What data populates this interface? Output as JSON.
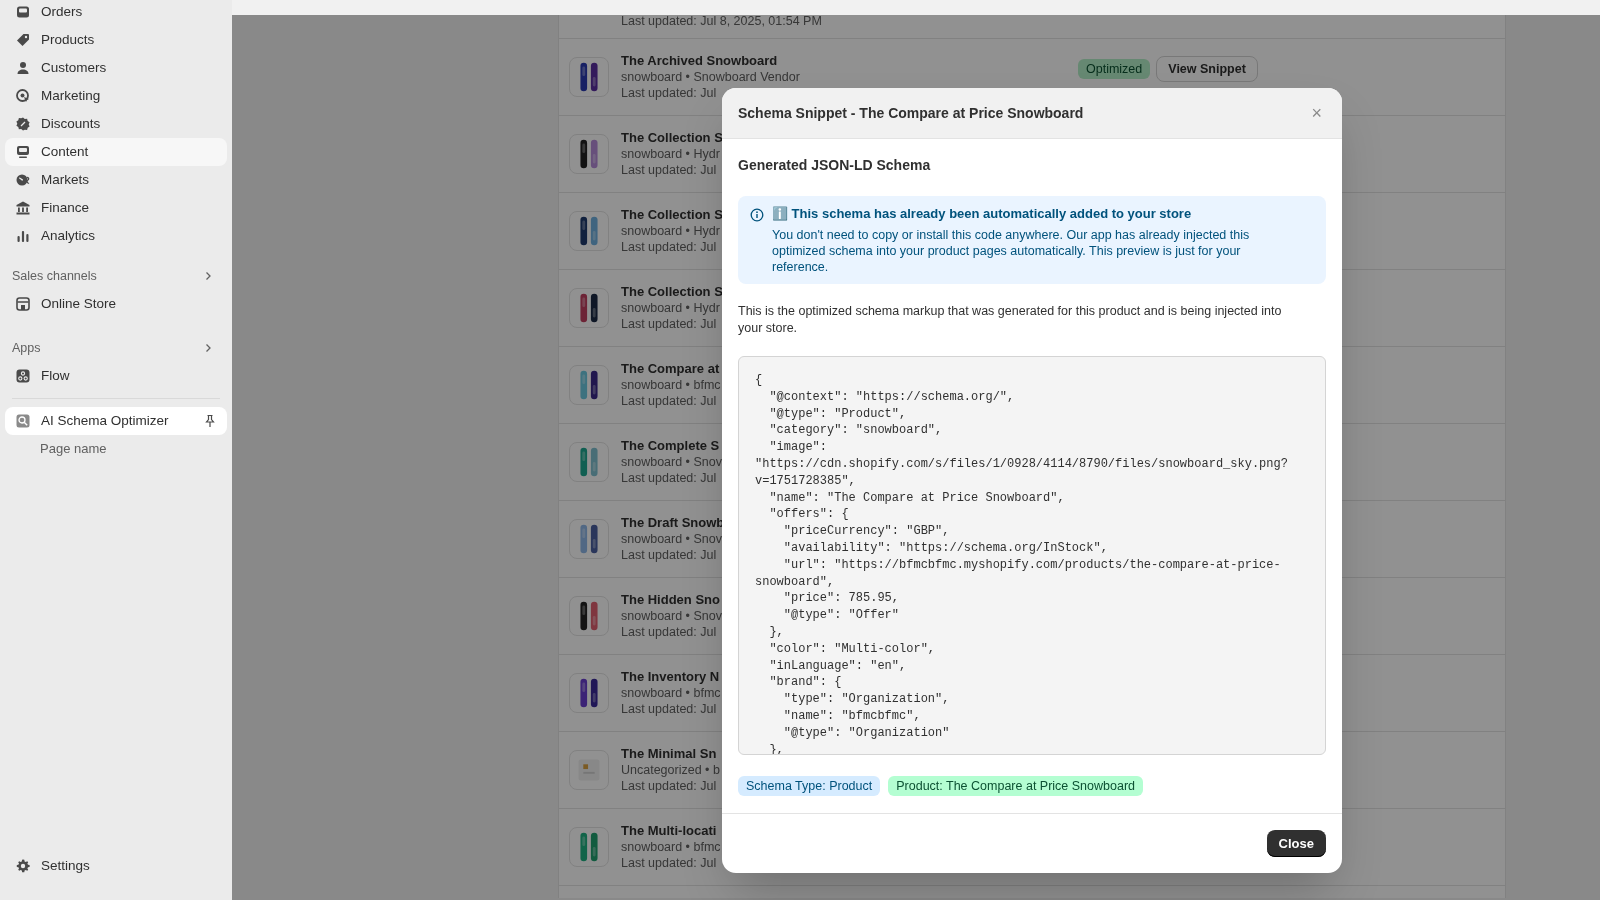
{
  "sidebar": {
    "nav": [
      {
        "label": "Orders",
        "selected": false
      },
      {
        "label": "Products",
        "selected": false
      },
      {
        "label": "Customers",
        "selected": false
      },
      {
        "label": "Marketing",
        "selected": false
      },
      {
        "label": "Discounts",
        "selected": false
      },
      {
        "label": "Content",
        "selected": true
      },
      {
        "label": "Markets",
        "selected": false
      },
      {
        "label": "Finance",
        "selected": false
      },
      {
        "label": "Analytics",
        "selected": false
      }
    ],
    "sales_channels": {
      "heading": "Sales channels",
      "items": [
        {
          "label": "Online Store"
        }
      ]
    },
    "apps": {
      "heading": "Apps",
      "items": [
        {
          "label": "Flow",
          "selected": false
        }
      ]
    },
    "app": {
      "label": "AI Schema Optimizer",
      "selected": true,
      "subitems": [
        "Page name"
      ]
    },
    "settings": "Settings"
  },
  "product_list": {
    "top_row_updated": "Last updated: Jul 8, 2025, 01:54 PM",
    "rows": [
      {
        "title": "The Archived Snowboard",
        "subtitle": "snowboard • Snowboard Vendor",
        "updated": "Last updated: Jul",
        "status": "Optimized",
        "action": "View Snippet"
      },
      {
        "title": "The Collection S",
        "subtitle": "snowboard • Hydr",
        "updated": "Last updated: Jul"
      },
      {
        "title": "The Collection S",
        "subtitle": "snowboard • Hydr",
        "updated": "Last updated: Jul"
      },
      {
        "title": "The Collection S",
        "subtitle": "snowboard • Hydr",
        "updated": "Last updated: Jul"
      },
      {
        "title": "The Compare at",
        "subtitle": "snowboard • bfmc",
        "updated": "Last updated: Jul"
      },
      {
        "title": "The Complete S",
        "subtitle": "snowboard • Snov",
        "updated": "Last updated: Jul"
      },
      {
        "title": "The Draft Snowb",
        "subtitle": "snowboard • Snov",
        "updated": "Last updated: Jul"
      },
      {
        "title": "The Hidden Sno",
        "subtitle": "snowboard • Snov",
        "updated": "Last updated: Jul"
      },
      {
        "title": "The Inventory N",
        "subtitle": "snowboard • bfmc",
        "updated": "Last updated: Jul"
      },
      {
        "title": "The Minimal Sn",
        "subtitle": "Uncategorized • b",
        "updated": "Last updated: Jul"
      },
      {
        "title": "The Multi-locati",
        "subtitle": "snowboard • bfmc",
        "updated": "Last updated: Jul"
      }
    ]
  },
  "modal": {
    "title": "Schema Snippet - The Compare at Price Snowboard",
    "close_icon": "×",
    "heading": "Generated JSON-LD Schema",
    "notice": {
      "title": "ℹ️ This schema has already been automatically added to your store",
      "body": "You don't need to copy or install this code anywhere. Our app has already injected this optimized schema into your product pages automatically. This preview is just for your reference."
    },
    "description": "This is the optimized schema markup that was generated for this product and is being injected into your store.",
    "code_lines": [
      "{",
      "  \"@context\": \"https://schema.org/\",",
      "  \"@type\": \"Product\",",
      "  \"category\": \"snowboard\",",
      "  \"image\":",
      "\"https://cdn.shopify.com/s/files/1/0928/4114/8790/files/snowboard_sky.png?",
      "v=1751728385\",",
      "  \"name\": \"The Compare at Price Snowboard\",",
      "  \"offers\": {",
      "    \"priceCurrency\": \"GBP\",",
      "    \"availability\": \"https://schema.org/InStock\",",
      "    \"url\": \"https://bfmcbfmc.myshopify.com/products/the-compare-at-price-",
      "snowboard\",",
      "    \"price\": 785.95,",
      "    \"@type\": \"Offer\"",
      "  },",
      "  \"color\": \"Multi-color\",",
      "  \"inLanguage\": \"en\",",
      "  \"brand\": {",
      "    \"type\": \"Organization\",",
      "    \"name\": \"bfmcbfmc\",",
      "    \"@type\": \"Organization\"",
      "  },"
    ],
    "tags": [
      {
        "label": "Schema Type: Product",
        "kind": "info"
      },
      {
        "label": "Product: The Compare at Price Snowboard",
        "kind": "success"
      }
    ],
    "close_button": "Close"
  }
}
